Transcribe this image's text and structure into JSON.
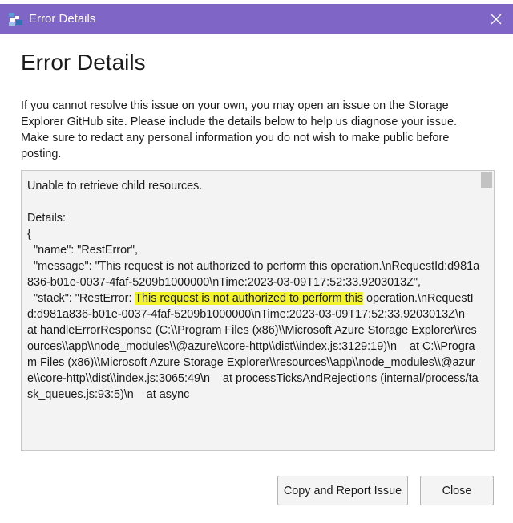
{
  "window": {
    "title": "Error Details",
    "icon": "storage-explorer-icon",
    "close_icon": "close-icon"
  },
  "dialog": {
    "heading": "Error Details",
    "intro": "If you cannot resolve this issue on your own, you may open an issue on the Storage Explorer GitHub site. Please include the details below to help us diagnose your issue. Make sure to redact any personal information you do not wish to make public before posting."
  },
  "details": {
    "part1": "Unable to retrieve child resources.\n\nDetails:\n{\n  \"name\": \"RestError\",\n  \"message\": \"This request is not authorized to perform this operation.\\nRequestId:d981a836-b01e-0037-4faf-5209b1000000\\nTime:2023-03-09T17:52:33.9203013Z\",\n  \"stack\": \"RestError: ",
    "highlighted": "This request is not authorized to perform this",
    "part2": " operation.\\nRequestId:d981a836-b01e-0037-4faf-5209b1000000\\nTime:2023-03-09T17:52:33.9203013Z\\n    at handleErrorResponse (C:\\\\Program Files (x86)\\\\Microsoft Azure Storage Explorer\\\\resources\\\\app\\\\node_modules\\\\@azure\\\\core-http\\\\dist\\\\index.js:3129:19)\\n    at C:\\\\Program Files (x86)\\\\Microsoft Azure Storage Explorer\\\\resources\\\\app\\\\node_modules\\\\@azure\\\\core-http\\\\dist\\\\index.js:3065:49\\n    at processTicksAndRejections (internal/process/task_queues.js:93:5)\\n    at async"
  },
  "buttons": {
    "report": "Copy and Report Issue",
    "close": "Close"
  },
  "colors": {
    "titlebar": "#7f66c6",
    "highlight": "#f3f32a",
    "details_bg": "#f3f3f3"
  }
}
